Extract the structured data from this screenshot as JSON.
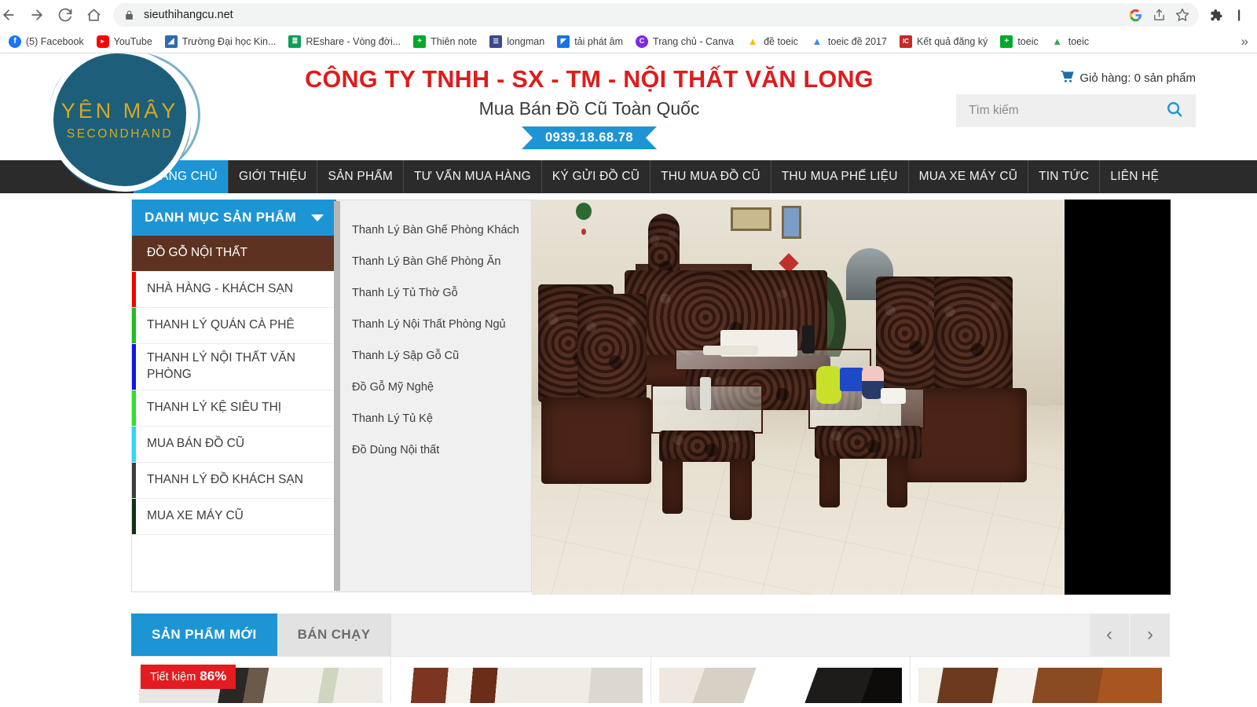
{
  "browser": {
    "url": "sieuthihangcu.net",
    "nav_icons": [
      "back-arrow-icon",
      "forward-arrow-icon",
      "reload-icon",
      "home-icon"
    ],
    "omnibox_icons": [
      "google-icon",
      "share-icon",
      "bookmark-star-icon"
    ],
    "extension_icons": [
      "puzzle-extensions-icon",
      "profile-icon"
    ],
    "bookmarks": [
      {
        "label": "(5) Facebook",
        "icon": "facebook-icon",
        "color": "#1877f2",
        "glyph": "f"
      },
      {
        "label": "YouTube",
        "icon": "youtube-icon",
        "color": "#ff0000",
        "glyph": "▶"
      },
      {
        "label": "Trường Đại học Kin...",
        "icon": "university-icon",
        "color": "#2b6cb0",
        "glyph": "◩"
      },
      {
        "label": "REshare - Vòng đời...",
        "icon": "sheets-icon",
        "color": "#0f9d58",
        "glyph": "≡"
      },
      {
        "label": "Thiên note",
        "icon": "evernote-icon",
        "color": "#00a82d",
        "glyph": "+"
      },
      {
        "label": "longman",
        "icon": "longman-icon",
        "color": "#3b4a8c",
        "glyph": "☰"
      },
      {
        "label": "tải phát âm",
        "icon": "blue-page-icon",
        "color": "#1a73e8",
        "glyph": "◤"
      },
      {
        "label": "Trang chủ - Canva",
        "icon": "canva-icon",
        "color": "#7d2ae8",
        "glyph": "C"
      },
      {
        "label": "đề toeic",
        "icon": "google-drive-icon",
        "color": "#fbbc04",
        "glyph": "△"
      },
      {
        "label": "toeic đề 2017",
        "icon": "google-drive-icon",
        "color": "#4285f4",
        "glyph": "△"
      },
      {
        "label": "Kết quả đăng ký",
        "icon": "iig-icon",
        "color": "#c62828",
        "glyph": "IC"
      },
      {
        "label": "toeic",
        "icon": "evernote-icon",
        "color": "#00a82d",
        "glyph": "+"
      },
      {
        "label": "toeic",
        "icon": "google-drive-icon",
        "color": "#34a853",
        "glyph": "△"
      }
    ],
    "overflow_label": "»"
  },
  "site": {
    "logo": {
      "line1": "YÊN MÂY",
      "line2": "SECONDHAND",
      "blob_color": "#1d5f7a",
      "text_color": "#d8a820"
    },
    "title": "CÔNG TY TNHH - SX - TM - NỘI THẤT VĂN LONG",
    "subtitle": "Mua Bán Đồ Cũ Toàn Quốc",
    "phone": "0939.18.68.78",
    "title_color": "#e01b1b",
    "accent_color": "#1d95d4",
    "cart": {
      "icon": "shopping-cart-icon",
      "label": "Giỏ hàng: 0 sản phẩm"
    },
    "search": {
      "placeholder": "Tìm kiếm",
      "value": "",
      "icon": "search-icon"
    }
  },
  "nav": {
    "items": [
      {
        "label": "TRANG CHỦ",
        "active": true
      },
      {
        "label": "GIỚI THIỆU",
        "active": false
      },
      {
        "label": "SẢN PHẨM",
        "active": false
      },
      {
        "label": "TƯ VẤN MUA HÀNG",
        "active": false
      },
      {
        "label": "KÝ GỬI ĐỒ CŨ",
        "active": false
      },
      {
        "label": "THU MUA ĐỒ CŨ",
        "active": false
      },
      {
        "label": "THU MUA PHẾ LIỆU",
        "active": false
      },
      {
        "label": "MUA XE MÁY CŨ",
        "active": false
      },
      {
        "label": "TIN TỨC",
        "active": false
      },
      {
        "label": "LIÊN HỆ",
        "active": false
      }
    ]
  },
  "categories": {
    "header": "DANH MỤC SẢN PHẨM",
    "caret_icon": "chevron-down-icon",
    "items": [
      {
        "label": "ĐỒ GỖ NỘI THẤT",
        "bar": "#5d3220",
        "active": true
      },
      {
        "label": "NHÀ HÀNG - KHÁCH SẠN",
        "bar": "#f40000",
        "active": false
      },
      {
        "label": "THANH LÝ QUÁN CÀ PHÊ",
        "bar": "#1fbf1f",
        "active": false
      },
      {
        "label": "THANH LÝ NỘI THẤT VĂN PHÒNG",
        "bar": "#1414e6",
        "active": false
      },
      {
        "label": "THANH LÝ KỆ SIÊU THỊ",
        "bar": "#2ee02e",
        "active": false
      },
      {
        "label": "MUA BÁN ĐỒ CŨ",
        "bar": "#33d6f2",
        "active": false
      },
      {
        "label": "THANH LÝ ĐỒ KHÁCH SẠN",
        "bar": "#3d3d3d",
        "active": false
      },
      {
        "label": "MUA XE MÁY CŨ",
        "bar": "#0d3314",
        "active": false
      }
    ]
  },
  "submenu": {
    "items": [
      {
        "label": "Thanh Lý Bàn Ghế Phòng Khách"
      },
      {
        "label": "Thanh Lý Bàn Ghế Phòng Ăn"
      },
      {
        "label": "Thanh Lý Tủ Thờ Gỗ"
      },
      {
        "label": "Thanh Lý Nội Thất Phòng Ngủ"
      },
      {
        "label": "Thanh Lý Sập Gỗ Cũ"
      },
      {
        "label": "Đồ Gỗ Mỹ Nghệ"
      },
      {
        "label": "Thanh Lý Tủ Kệ"
      },
      {
        "label": "Đồ Dùng Nội thất"
      }
    ]
  },
  "hero": {
    "alt": "Bộ bàn ghế gỗ chạm khắc phòng khách",
    "name": "hero-banner-image"
  },
  "product_section": {
    "tabs": [
      {
        "label": "SẢN PHẨM MỚI",
        "active": true
      },
      {
        "label": "BÁN CHẠY",
        "active": false
      }
    ],
    "prev_icon": "chevron-left-icon",
    "next_icon": "chevron-right-icon",
    "cards": [
      {
        "badge_label": "Tiết kiệm",
        "badge_value": "86%",
        "has_badge": true
      },
      {
        "badge_label": "",
        "badge_value": "",
        "has_badge": false
      },
      {
        "badge_label": "",
        "badge_value": "",
        "has_badge": false
      },
      {
        "badge_label": "",
        "badge_value": "",
        "has_badge": false
      }
    ]
  }
}
